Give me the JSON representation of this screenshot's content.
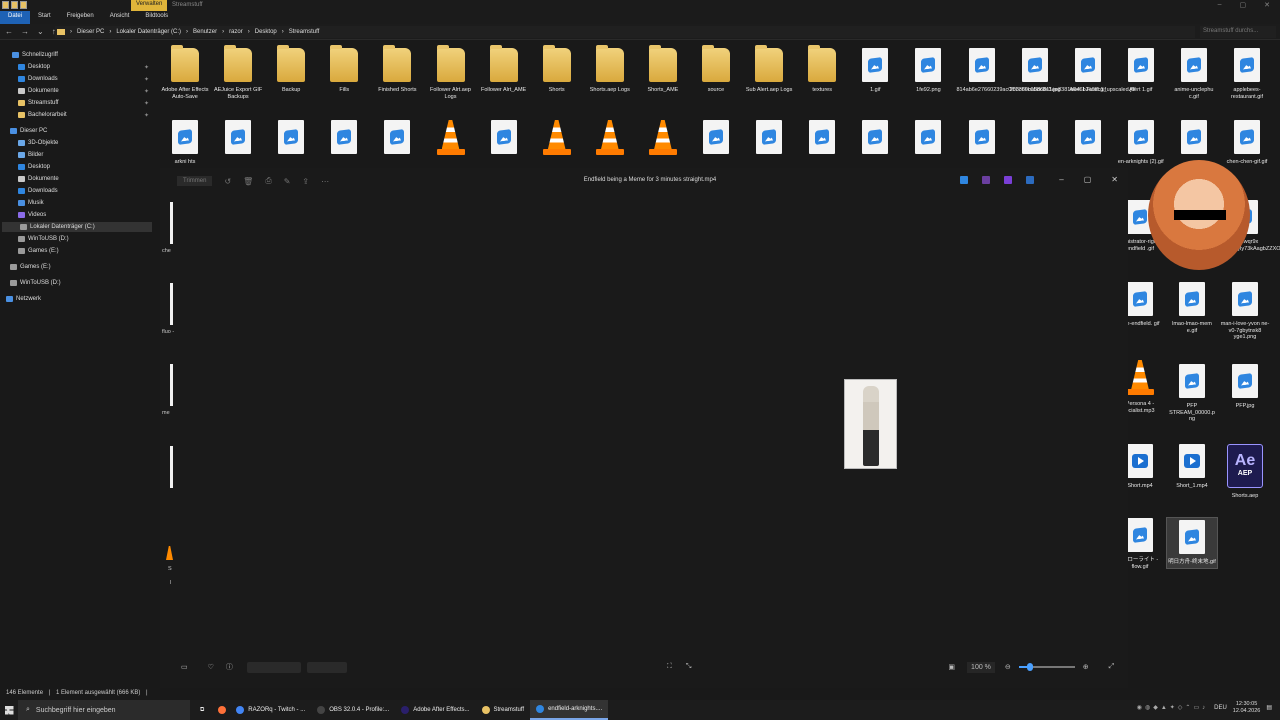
{
  "window": {
    "context_tab": "Verwalten",
    "title": "Streamstuff"
  },
  "ribbon_tabs": [
    "Datei",
    "Start",
    "Freigeben",
    "Ansicht",
    "Bildtools"
  ],
  "address": {
    "path": [
      "Dieser PC",
      "Lokaler Datenträger (C:)",
      "Benutzer",
      "razor",
      "Desktop",
      "Streamstuff"
    ],
    "search_placeholder": "Streamstuff durchs..."
  },
  "sidebar": [
    {
      "label": "Schnellzugriff",
      "icon": "star-icon",
      "pinned": false
    },
    {
      "label": "Desktop",
      "icon": "desktop-icon",
      "pinned": true
    },
    {
      "label": "Downloads",
      "icon": "download-icon",
      "pinned": true
    },
    {
      "label": "Dokumente",
      "icon": "documents-icon",
      "pinned": true
    },
    {
      "label": "Streamstuff",
      "icon": "folder-icon",
      "pinned": true
    },
    {
      "label": "Bachelorarbeit",
      "icon": "folder-icon",
      "pinned": true
    },
    {
      "label": "Dieser PC",
      "icon": "pc-icon",
      "pinned": false
    },
    {
      "label": "3D-Objekte",
      "icon": "cube-icon",
      "pinned": false
    },
    {
      "label": "Bilder",
      "icon": "pictures-icon",
      "pinned": false
    },
    {
      "label": "Desktop",
      "icon": "desktop-icon",
      "pinned": false
    },
    {
      "label": "Dokumente",
      "icon": "documents-icon",
      "pinned": false
    },
    {
      "label": "Downloads",
      "icon": "download-icon",
      "pinned": false
    },
    {
      "label": "Musik",
      "icon": "music-icon",
      "pinned": false
    },
    {
      "label": "Videos",
      "icon": "video-icon",
      "pinned": false
    },
    {
      "label": "Lokaler Datenträger (C:)",
      "icon": "drive-icon",
      "pinned": false,
      "selected": true
    },
    {
      "label": "WinToUSB (D:)",
      "icon": "drive-icon",
      "pinned": false
    },
    {
      "label": "Games (E:)",
      "icon": "drive-icon",
      "pinned": false
    },
    {
      "label": "Games (E:)",
      "icon": "drive-icon",
      "pinned": false
    },
    {
      "label": "WinToUSB (D:)",
      "icon": "drive-icon",
      "pinned": false
    },
    {
      "label": "Netzwerk",
      "icon": "network-icon",
      "pinned": false
    }
  ],
  "files_row1": [
    {
      "name": "Adobe After Effects Auto-Save",
      "type": "folder"
    },
    {
      "name": "AEJuice Export GIF Backups",
      "type": "folder"
    },
    {
      "name": "Backup",
      "type": "folder"
    },
    {
      "name": "Fills",
      "type": "folder"
    },
    {
      "name": "Finished Shorts",
      "type": "folder"
    },
    {
      "name": "Follower Alrt.aep Logs",
      "type": "folder"
    },
    {
      "name": "Follower Alrt_AME",
      "type": "folder"
    },
    {
      "name": "Shorts",
      "type": "folder"
    },
    {
      "name": "Shorts.aep Logs",
      "type": "folder"
    },
    {
      "name": "Shorts_AME",
      "type": "folder"
    },
    {
      "name": "source",
      "type": "folder"
    },
    {
      "name": "Sub Alert.aep Logs",
      "type": "folder"
    },
    {
      "name": "textures",
      "type": "folder"
    },
    {
      "name": "1.gif",
      "type": "image"
    },
    {
      "name": "1fe92.png",
      "type": "image"
    },
    {
      "name": "814ab6e27660239ac0f83c66c058c8e3.jpg",
      "type": "image"
    },
    {
      "name": "208389ba8d6811ee8381b646b2a0ffc1_upscaled.jfif",
      "type": "image"
    },
    {
      "name": "Alert 1 Final.gif",
      "type": "image"
    },
    {
      "name": "Alert 1.gif",
      "type": "image"
    },
    {
      "name": "anime-unclephu c.gif",
      "type": "image"
    },
    {
      "name": "applebees-restaurant.gif",
      "type": "image"
    }
  ],
  "files_row2": [
    {
      "name": "arkni hts",
      "type": "image"
    },
    {
      "name": "",
      "type": "image"
    },
    {
      "name": "",
      "type": "image"
    },
    {
      "name": "",
      "type": "image"
    },
    {
      "name": "",
      "type": "image"
    },
    {
      "name": "",
      "type": "vlc"
    },
    {
      "name": "",
      "type": "image"
    },
    {
      "name": "",
      "type": "vlc"
    },
    {
      "name": "",
      "type": "vlc"
    },
    {
      "name": "",
      "type": "vlc"
    },
    {
      "name": "",
      "type": "image"
    },
    {
      "name": "",
      "type": "image"
    },
    {
      "name": "",
      "type": "image"
    },
    {
      "name": "",
      "type": "image"
    },
    {
      "name": "",
      "type": "image"
    },
    {
      "name": "",
      "type": "image"
    },
    {
      "name": "",
      "type": "image"
    },
    {
      "name": "",
      "type": "image"
    },
    {
      "name": "en-arknights (2).gif",
      "type": "image"
    },
    {
      "name": "",
      "type": "image"
    },
    {
      "name": "chen-chen-gif.gif",
      "type": "image"
    }
  ],
  "files_right": [
    {
      "name": "dministrator-rights-endfield .gif",
      "type": "image"
    },
    {
      "name": "2s3uwqr9x d0c8KQIy73kAagbZZXOm.png",
      "type": "image"
    },
    {
      "name": "trite-endfield. gif",
      "type": "image"
    },
    {
      "name": "lmao-lmao-mem e.gif",
      "type": "image"
    },
    {
      "name": "man-i-love-yvon ne-v0-7gbytnxk8 yge1.png",
      "type": "image"
    },
    {
      "name": "Persona 4 - ecialist.mp3",
      "type": "vlc"
    },
    {
      "name": "PFP STREAM_00000.p ng",
      "type": "image"
    },
    {
      "name": "PFP.jpg",
      "type": "image"
    },
    {
      "name": "Short.mp4",
      "type": "video"
    },
    {
      "name": "Short_1.mp4",
      "type": "video"
    },
    {
      "name": "Shorts.aep",
      "type": "aep"
    },
    {
      "name": "フローライト -flow.gif",
      "type": "image"
    },
    {
      "name": "明日方舟-终末地.gif",
      "type": "image",
      "selected": true
    }
  ],
  "left_strip_labels": [
    "che",
    "fluo -",
    "me",
    "",
    "S",
    "l"
  ],
  "viewer": {
    "title": "Endfield being a Meme for 3 minutes straight.mp4",
    "trim_label": "Trimmen",
    "zoom": "100 %",
    "zoom_level": 0.2
  },
  "aep_text": {
    "logo": "Ae",
    "sub": "AEP"
  },
  "status": {
    "count": "146 Elemente",
    "selected": "1 Element ausgewählt (666 KB)"
  },
  "taskbar": {
    "search_placeholder": "Suchbegriff hier eingeben",
    "items": [
      {
        "label": "RAZORq - Twitch - ...",
        "color": "#4285f4",
        "active": false
      },
      {
        "label": "OBS 32.0.4 - Profile:...",
        "color": "#444444",
        "active": false
      },
      {
        "label": "Adobe After Effects...",
        "color": "#2a1f6b",
        "active": false
      },
      {
        "label": "Streamstuff",
        "color": "#e8c265",
        "active": false
      },
      {
        "label": "endfield-arknights....",
        "color": "#2f86e0",
        "active": true
      }
    ],
    "lang": "DEU",
    "time": "12:30:05",
    "date": "12.04.2026"
  }
}
